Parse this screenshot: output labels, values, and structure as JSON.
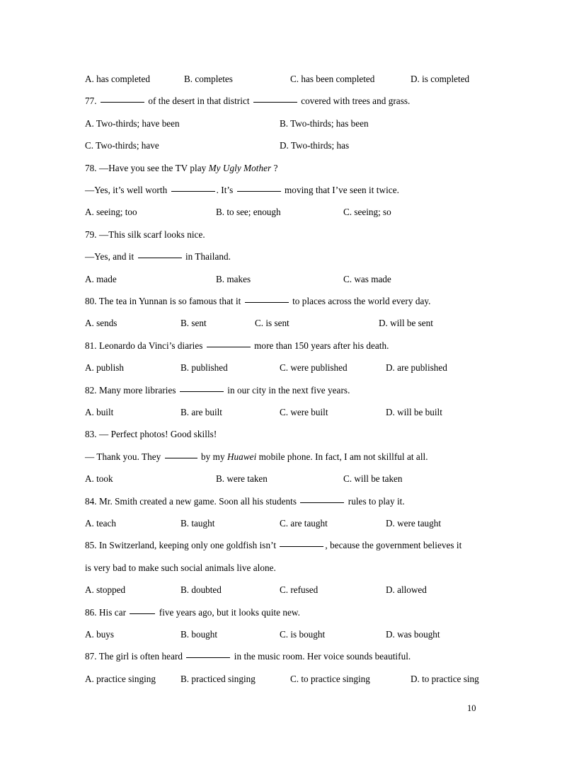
{
  "page": {
    "number": "10",
    "background": "#ffffff",
    "text_color": "#000000"
  },
  "questions": [
    {
      "id": "q76-options",
      "options_only": true,
      "options": [
        {
          "label": "A. has completed"
        },
        {
          "label": "B. completes"
        },
        {
          "label": "C. has been completed"
        },
        {
          "label": "D. is completed"
        }
      ]
    },
    {
      "id": "q77",
      "stem_prefix": "77. ",
      "stem_mid": " of the desert in that district ",
      "stem_suffix": " covered with trees and grass.",
      "options": [
        {
          "label": "A. Two-thirds; have been"
        },
        {
          "label": "B. Two-thirds; has been"
        },
        {
          "label": "C. Two-thirds; have"
        },
        {
          "label": "D. Two-thirds; has"
        }
      ]
    },
    {
      "id": "q78",
      "line1_a": "78. —Have you see the TV play ",
      "line1_italic": "My Ugly Mother",
      "line1_b": " ?",
      "line2_a": "—Yes, it’s well worth ",
      "line2_b": ". It’s ",
      "line2_c": " moving that I’ve seen it twice.",
      "options": [
        {
          "label": "A. seeing; too"
        },
        {
          "label": "B. to see; enough"
        },
        {
          "label": "C. seeing; so"
        }
      ]
    },
    {
      "id": "q79",
      "line1": "79. —This silk scarf looks nice.",
      "line2_a": "—Yes, and it ",
      "line2_b": " in Thailand.",
      "options": [
        {
          "label": "A. made"
        },
        {
          "label": "B. makes"
        },
        {
          "label": "C. was made"
        }
      ]
    },
    {
      "id": "q80",
      "stem_prefix": "80. The tea in Yunnan is so famous that it ",
      "stem_suffix": " to places across the world every day.",
      "options": [
        {
          "label": "A. sends"
        },
        {
          "label": "B. sent"
        },
        {
          "label": "C. is sent"
        },
        {
          "label": "D. will be sent"
        }
      ]
    },
    {
      "id": "q81",
      "stem_prefix": "81. Leonardo da Vinci’s diaries ",
      "stem_suffix": " more than 150 years after his death.",
      "options": [
        {
          "label": "A. publish"
        },
        {
          "label": "B. published"
        },
        {
          "label": "C. were published"
        },
        {
          "label": "D. are published"
        }
      ]
    },
    {
      "id": "q82",
      "stem_prefix": "82. Many more libraries ",
      "stem_suffix": " in our city in the next five years.",
      "options": [
        {
          "label": "A. built"
        },
        {
          "label": "B. are built"
        },
        {
          "label": "C. were built"
        },
        {
          "label": "D. will be built"
        }
      ]
    },
    {
      "id": "q83",
      "line1": "83. — Perfect photos! Good skills!",
      "line2_a": "— Thank you. They ",
      "line2_b": " by my ",
      "line2_italic": "Huawei",
      "line2_c": " mobile phone. In fact, I am not skillful at all.",
      "options": [
        {
          "label": "A. took"
        },
        {
          "label": "B. were taken"
        },
        {
          "label": "C. will be taken"
        }
      ]
    },
    {
      "id": "q84",
      "stem_prefix": "84. Mr. Smith created a new game. Soon all his students ",
      "stem_suffix": " rules to play it.",
      "options": [
        {
          "label": "A. teach"
        },
        {
          "label": "B. taught"
        },
        {
          "label": "C. are taught"
        },
        {
          "label": "D. were taught"
        }
      ]
    },
    {
      "id": "q85",
      "stem_prefix": "85. In Switzerland, keeping only one goldfish isn’t ",
      "stem_suffix": ", because the government believes it",
      "stem_line2": "is very bad to make such social animals live alone.",
      "options": [
        {
          "label": "A. stopped"
        },
        {
          "label": "B. doubted"
        },
        {
          "label": "C. refused"
        },
        {
          "label": "D. allowed"
        }
      ]
    },
    {
      "id": "q86",
      "stem_prefix": "86. His car ",
      "stem_suffix": " five years ago, but it looks quite new.",
      "options": [
        {
          "label": "A. buys"
        },
        {
          "label": "B. bought"
        },
        {
          "label": "C. is bought"
        },
        {
          "label": "D. was bought"
        }
      ]
    },
    {
      "id": "q87",
      "stem_prefix": "87. The girl is often heard ",
      "stem_suffix": " in the music room. Her voice sounds beautiful.",
      "options": [
        {
          "label": "A. practice singing"
        },
        {
          "label": "B. practiced singing"
        },
        {
          "label": "C. to practice singing"
        },
        {
          "label": "D. to practice sing"
        }
      ]
    }
  ]
}
